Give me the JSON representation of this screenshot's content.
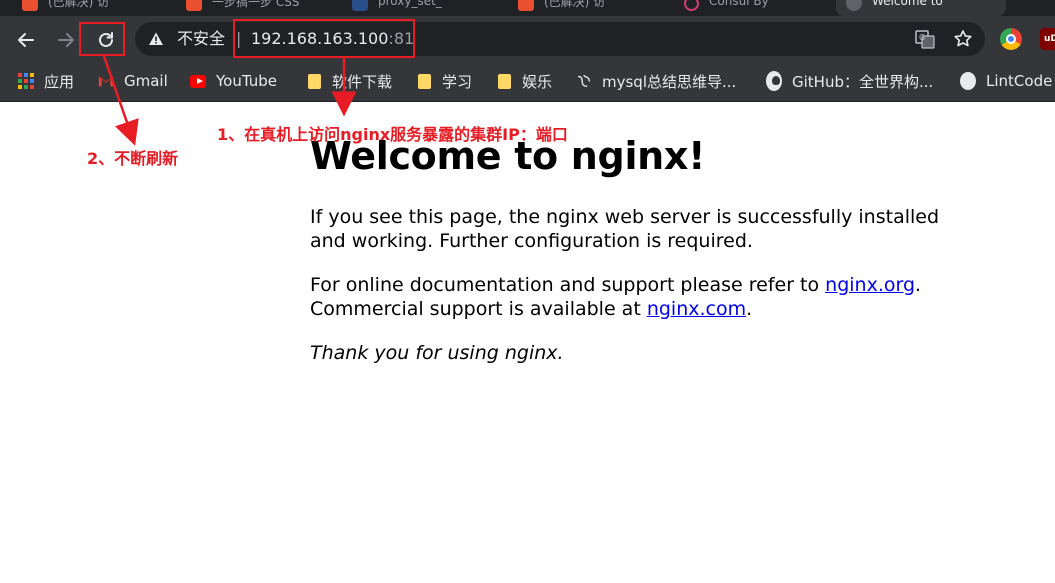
{
  "browser": {
    "tabs": [
      {
        "title": "(已解决) 访",
        "favicon": "csdn-icon"
      },
      {
        "title": "一步搞一步 CSS",
        "favicon": "csdn-icon"
      },
      {
        "title": "proxy_set_",
        "favicon": "docs-icon"
      },
      {
        "title": "(已解决) 访",
        "favicon": "csdn-icon"
      },
      {
        "title": "Consul By",
        "favicon": "consul-icon"
      },
      {
        "title": "Welcome to",
        "favicon": "globe-icon"
      }
    ],
    "omnibox": {
      "security_label": "不安全",
      "separator": "|",
      "url_host": "192.168.163.100",
      "url_port": ":81"
    },
    "bookmarks": [
      {
        "label": "应用",
        "icon": "apps-grid-icon"
      },
      {
        "label": "Gmail",
        "icon": "gmail-icon"
      },
      {
        "label": "YouTube",
        "icon": "youtube-icon"
      },
      {
        "label": "软件下载",
        "icon": "folder-icon"
      },
      {
        "label": "学习",
        "icon": "folder-icon"
      },
      {
        "label": "娱乐",
        "icon": "folder-icon"
      },
      {
        "label": "mysql总结思维导...",
        "icon": "bookmark-icon"
      },
      {
        "label": "GitHub：全世界构...",
        "icon": "github-icon"
      },
      {
        "label": "LintCode",
        "icon": "globe-icon"
      }
    ],
    "extensions": [
      {
        "label": "uD",
        "icon": "ublock-icon"
      }
    ]
  },
  "page": {
    "heading": "Welcome to nginx!",
    "para1": "If you see this page, the nginx web server is successfully installed and working. Further configuration is required.",
    "para2_pre": "For online documentation and support please refer to ",
    "para2_link1": "nginx.org",
    "para2_mid": ".",
    "para2_line2_pre": "Commercial support is available at ",
    "para2_link2": "nginx.com",
    "para2_end": ".",
    "para3": "Thank you for using nginx."
  },
  "annotations": {
    "note1": "1、在真机上访问nginx服务暴露的集群IP：端口",
    "note2": "2、不断刷新",
    "color": "#e81c24"
  }
}
